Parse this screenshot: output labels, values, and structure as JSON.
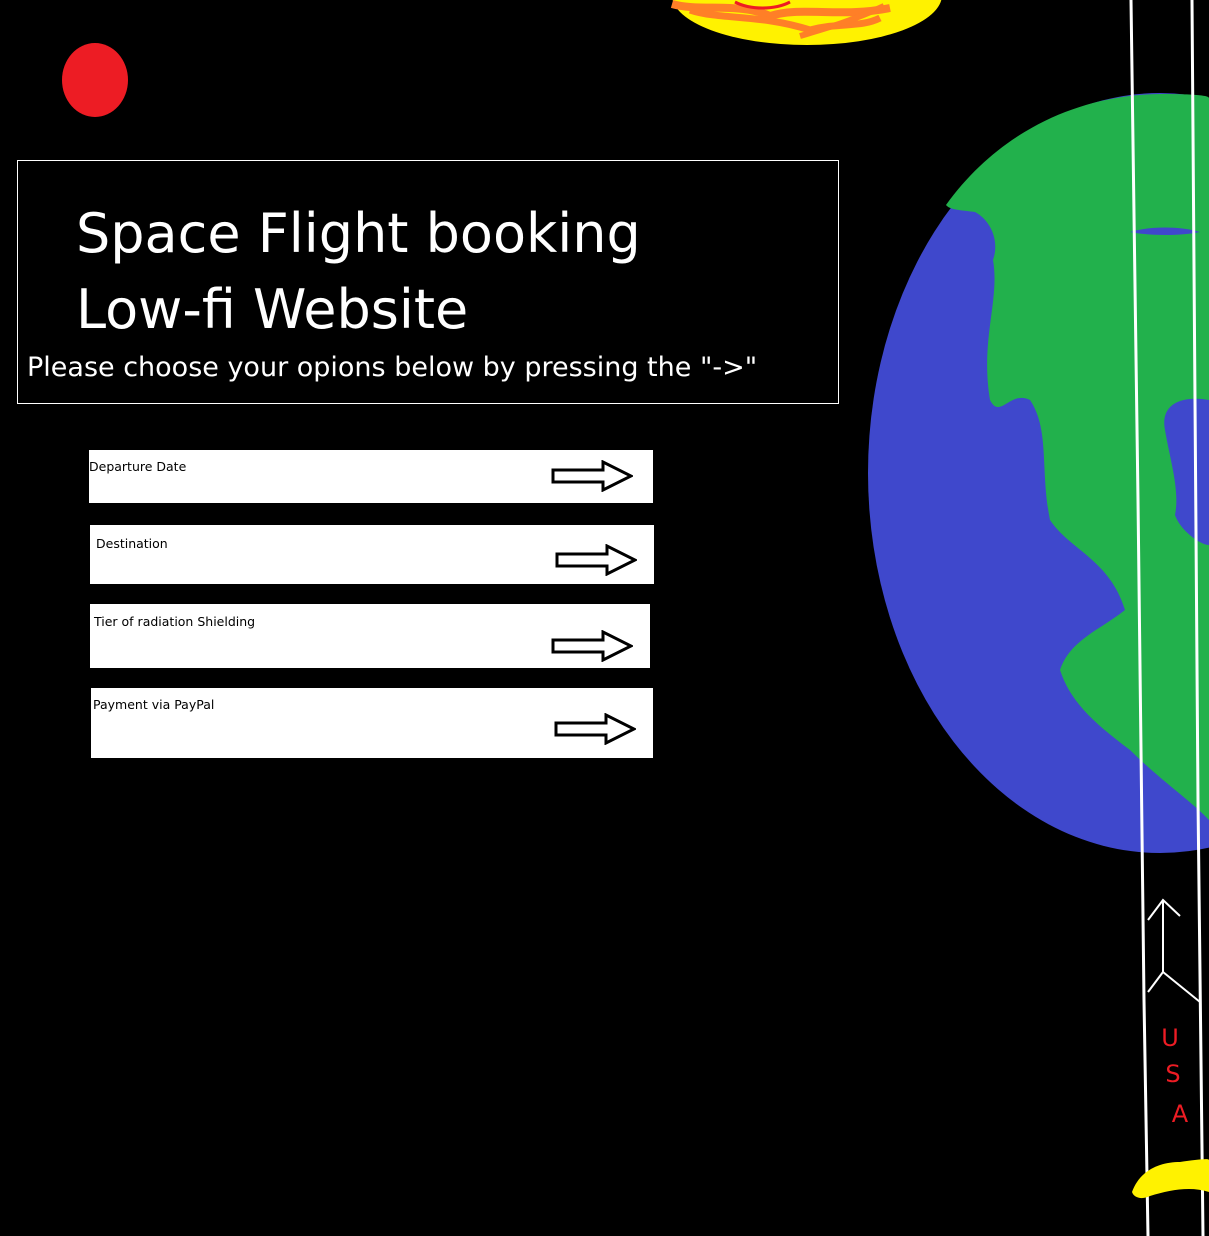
{
  "header": {
    "title_line1": "Space Flight booking",
    "title_line2": "Low-fi Website",
    "instructions": "Please choose your opions below by pressing the \"->\""
  },
  "options": [
    {
      "label": "Departure Date",
      "action_icon": "right-arrow-icon"
    },
    {
      "label": "Destination",
      "action_icon": "right-arrow-icon"
    },
    {
      "label": "Tier of radiation Shielding",
      "action_icon": "right-arrow-icon"
    },
    {
      "label": "Payment via PayPal",
      "action_icon": "right-arrow-icon"
    }
  ],
  "rocket": {
    "text": "USA",
    "letters": [
      "U",
      "S",
      "A"
    ]
  },
  "colors": {
    "background": "#000000",
    "foreground": "#ffffff",
    "red_dot": "#ed1c24",
    "sun_yellow": "#fff200",
    "sun_orange": "#ff7f27",
    "ocean_blue": "#3f48cc",
    "land_green": "#22b14c",
    "rocket_text": "#ed1c24",
    "flame_yellow": "#fff200"
  }
}
